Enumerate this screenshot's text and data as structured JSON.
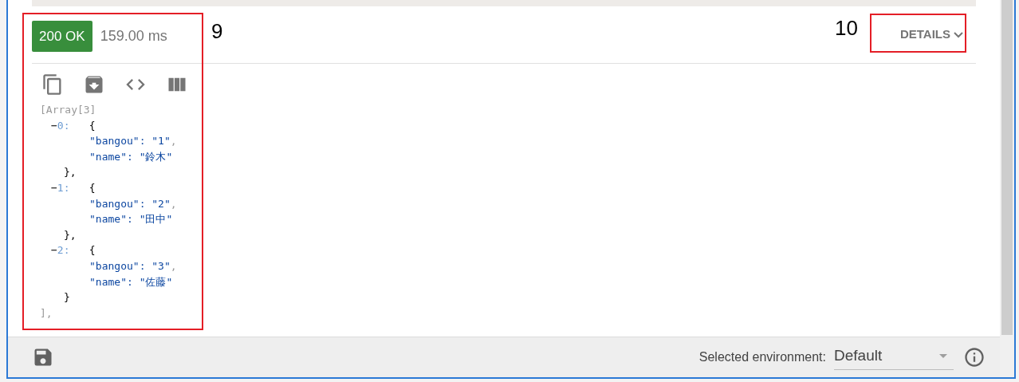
{
  "response": {
    "status": "200 OK",
    "time": "159.00 ms",
    "details_button": "DETAILS",
    "tree": {
      "open": "[Array[3]",
      "close": "],",
      "items": [
        {
          "toggle": "−",
          "index": "0:",
          "open": "{",
          "close": "},",
          "props": [
            {
              "key": "\"bangou\"",
              "sep": ":",
              "value": "\"1\"",
              "comma": ","
            },
            {
              "key": "\"name\"",
              "sep": ":",
              "value": "\"鈴木\""
            }
          ]
        },
        {
          "toggle": "−",
          "index": "1:",
          "open": "{",
          "close": "},",
          "props": [
            {
              "key": "\"bangou\"",
              "sep": ":",
              "value": "\"2\"",
              "comma": ","
            },
            {
              "key": "\"name\"",
              "sep": ":",
              "value": "\"田中\""
            }
          ]
        },
        {
          "toggle": "−",
          "index": "2:",
          "open": "{",
          "close": "}",
          "props": [
            {
              "key": "\"bangou\"",
              "sep": ":",
              "value": "\"3\"",
              "comma": ","
            },
            {
              "key": "\"name\"",
              "sep": ":",
              "value": "\"佐藤\""
            }
          ]
        }
      ]
    }
  },
  "callouts": [
    "9",
    "10"
  ],
  "footer": {
    "environment_label": "Selected environment:",
    "environment_value": "Default"
  }
}
